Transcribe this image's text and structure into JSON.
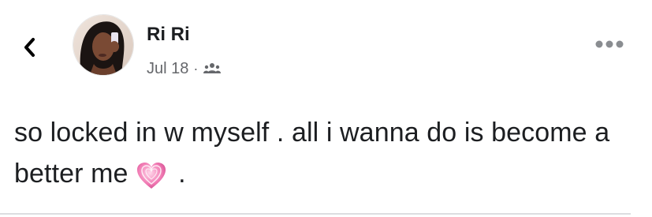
{
  "header": {
    "back_icon": "chevron-left-icon",
    "author_name": "Ri Ri",
    "date": "Jul 18",
    "separator": "·",
    "audience_icon": "friends-icon",
    "more_icon": "more-horizontal-icon"
  },
  "post": {
    "text": "so locked in w myself . all i wanna do is become a better me",
    "emoji": "growing-heart-emoji",
    "trailing_text": " ."
  },
  "colors": {
    "text": "#1c1e21",
    "meta": "#65676b",
    "divider": "#dcdde0",
    "heart_pink": "#e85a9b"
  }
}
